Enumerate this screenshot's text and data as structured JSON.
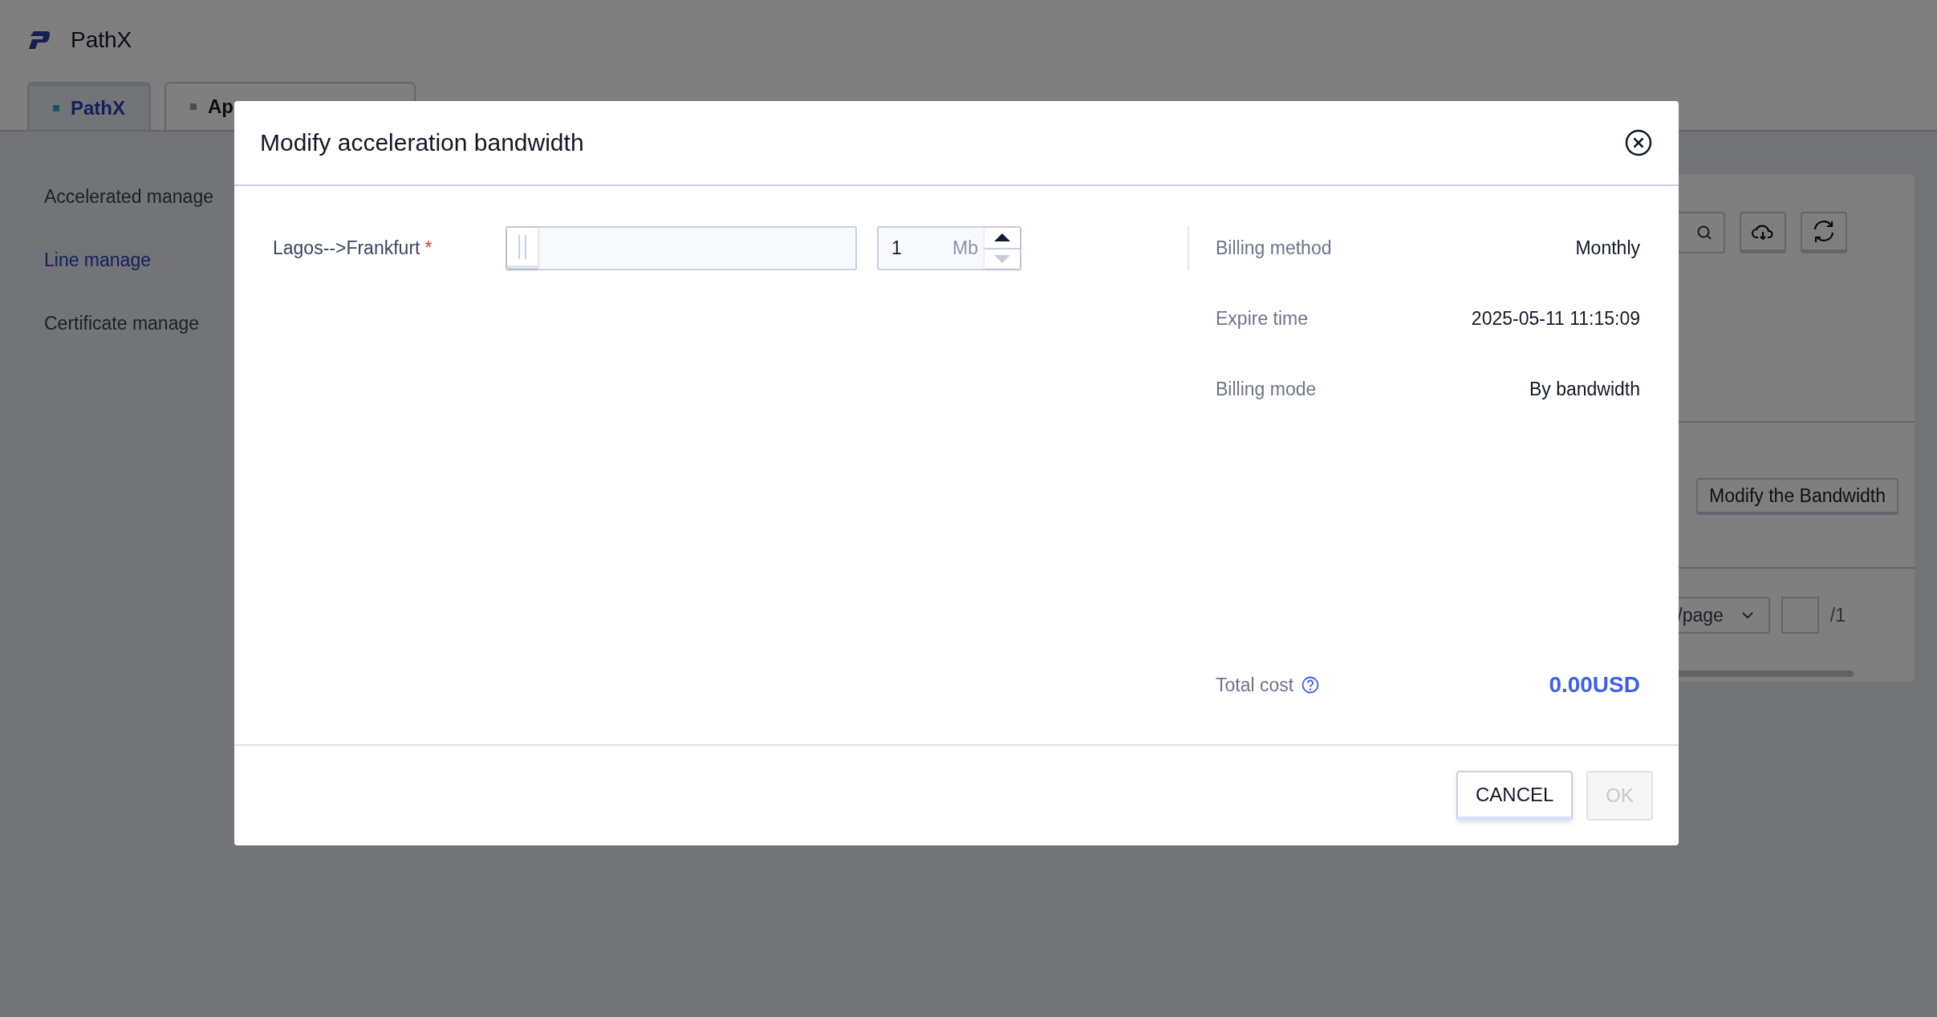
{
  "app": {
    "title": "PathX"
  },
  "tabs": [
    {
      "label": "PathX",
      "selected": true
    },
    {
      "label": "Ap",
      "selected": false
    }
  ],
  "sidebar": {
    "items": [
      {
        "label": "Accelerated manage",
        "selected": false
      },
      {
        "label": "Line manage",
        "selected": true
      },
      {
        "label": "Certificate manage",
        "selected": false
      }
    ]
  },
  "actions": [
    {
      "label": "Modify the Bandwidth"
    }
  ],
  "pagination": {
    "page_size": "/page",
    "page_total": "/1"
  },
  "dialog": {
    "title": "Modify acceleration bandwidth",
    "line": {
      "label": "Lagos-->Frankfurt",
      "required_mark": "*",
      "level": 0,
      "value": "1",
      "unit": "Mb",
      "up_disabled": false,
      "down_disabled": true
    },
    "details": [
      {
        "label": "Billing method",
        "value": "Monthly"
      },
      {
        "label": "Expire time",
        "value": "2025-05-11 11:15:09"
      },
      {
        "label": "Billing mode",
        "value": "By bandwidth"
      }
    ],
    "total": {
      "label": "Total cost",
      "value": "0.00USD"
    },
    "buttons": [
      {
        "label": "CANCEL",
        "disabled": false
      },
      {
        "label": "OK",
        "disabled": true
      }
    ]
  }
}
